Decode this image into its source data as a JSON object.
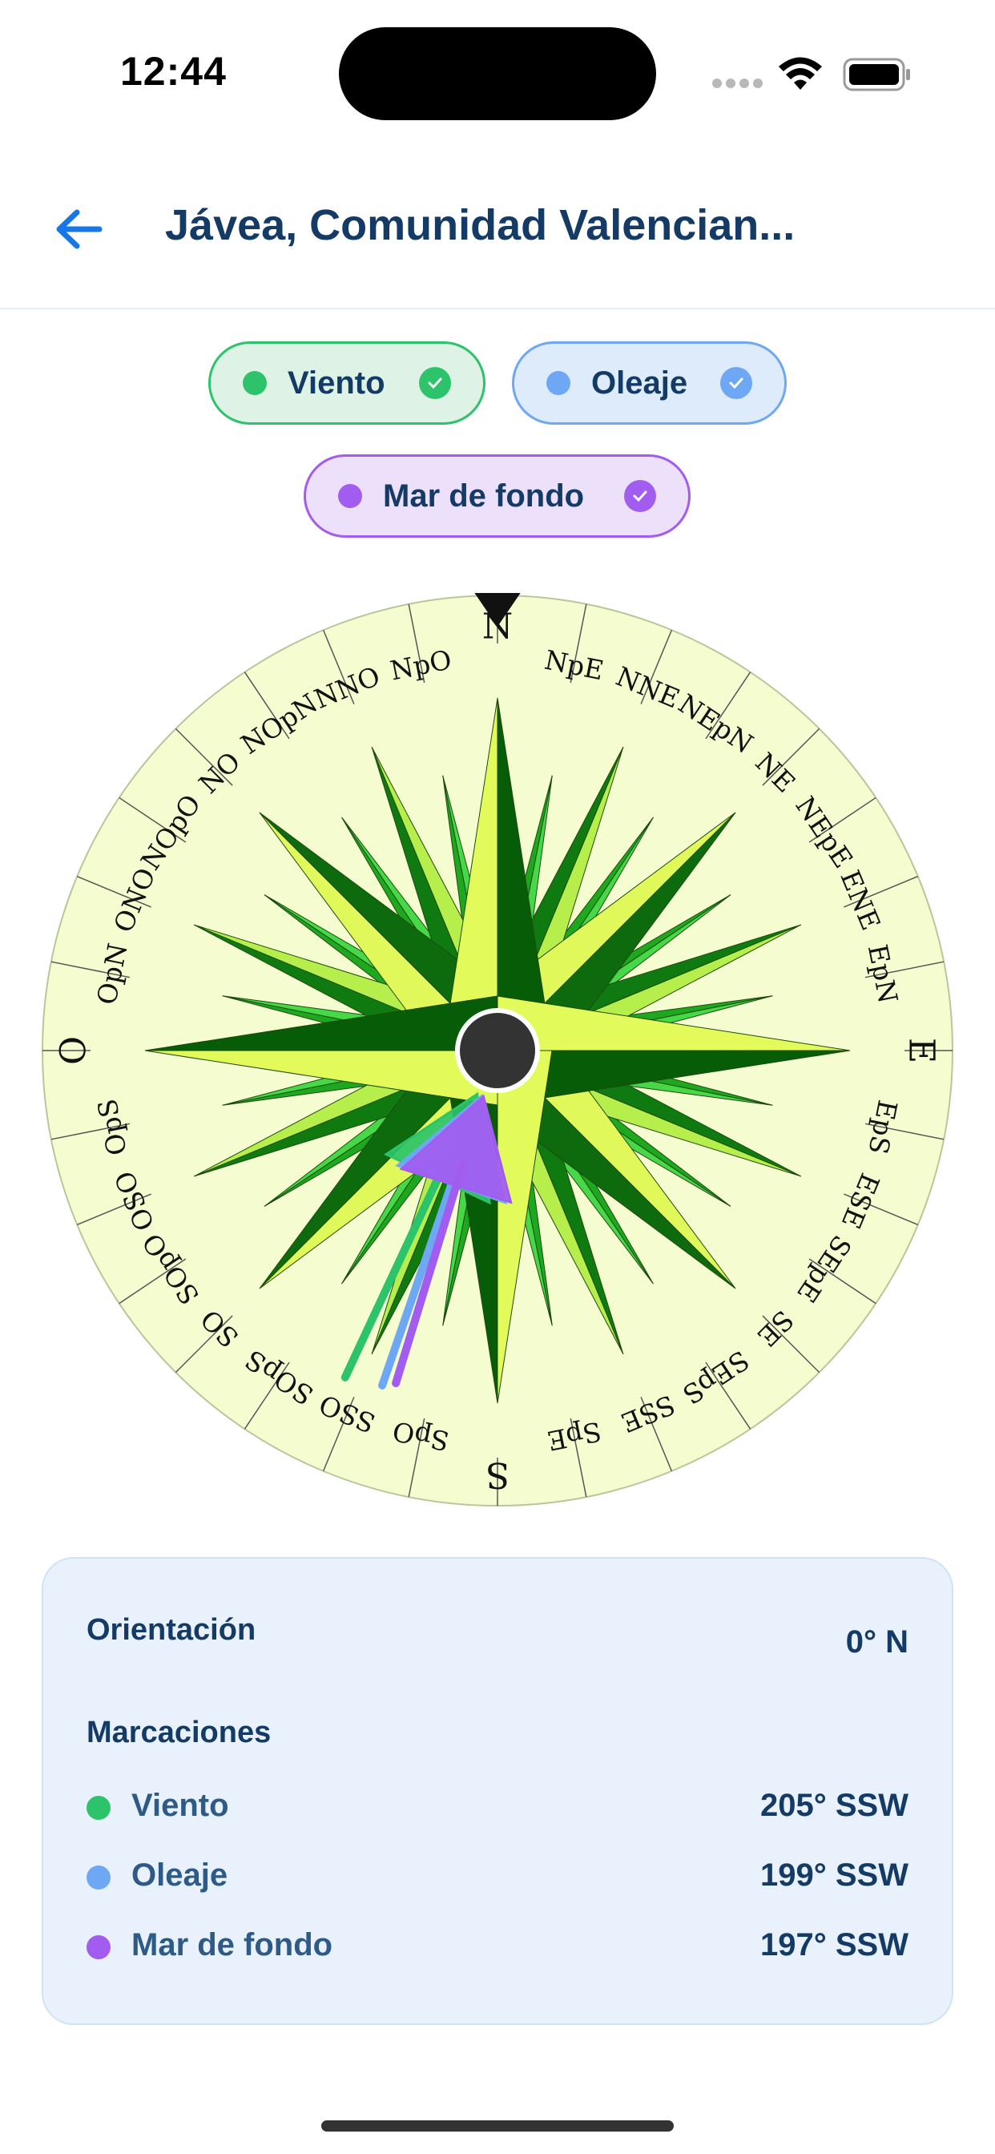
{
  "status_bar": {
    "time": "12:44"
  },
  "header": {
    "title": "Jávea, Comunidad Valencian..."
  },
  "chips": [
    {
      "label": "Viento",
      "color": "#2dc36a",
      "checked": true
    },
    {
      "label": "Oleaje",
      "color": "#6ea8f4",
      "checked": true
    },
    {
      "label": "Mar de fondo",
      "color": "#a35cf0",
      "checked": true
    }
  ],
  "compass": {
    "points": [
      "N",
      "NpE",
      "NNE",
      "NEpN",
      "NE",
      "NEpE",
      "ENE",
      "EpN",
      "E",
      "EpS",
      "ESE",
      "SEpE",
      "SE",
      "SEpS",
      "SSE",
      "SpE",
      "S",
      "SpO",
      "SSO",
      "SOpS",
      "SO",
      "SOpO",
      "OSO",
      "OpS",
      "O",
      "OpN",
      "ONO",
      "NOpO",
      "NO",
      "NOpN",
      "NNO",
      "NpO"
    ],
    "orientation_deg": 0,
    "markers": [
      {
        "name": "Viento",
        "deg": 205,
        "color": "#2dc36a"
      },
      {
        "name": "Oleaje",
        "deg": 199,
        "color": "#6ea8f4"
      },
      {
        "name": "Mar de fondo",
        "deg": 197,
        "color": "#a35cf0"
      }
    ]
  },
  "info": {
    "orientation_label": "Orientación",
    "orientation_value": "0° N",
    "markings_label": "Marcaciones",
    "markings": [
      {
        "name": "Viento",
        "value": "205° SSW",
        "color": "#2dc36a"
      },
      {
        "name": "Oleaje",
        "value": "199° SSW",
        "color": "#6ea8f4"
      },
      {
        "name": "Mar de fondo",
        "value": "197° SSW",
        "color": "#a35cf0"
      }
    ]
  }
}
